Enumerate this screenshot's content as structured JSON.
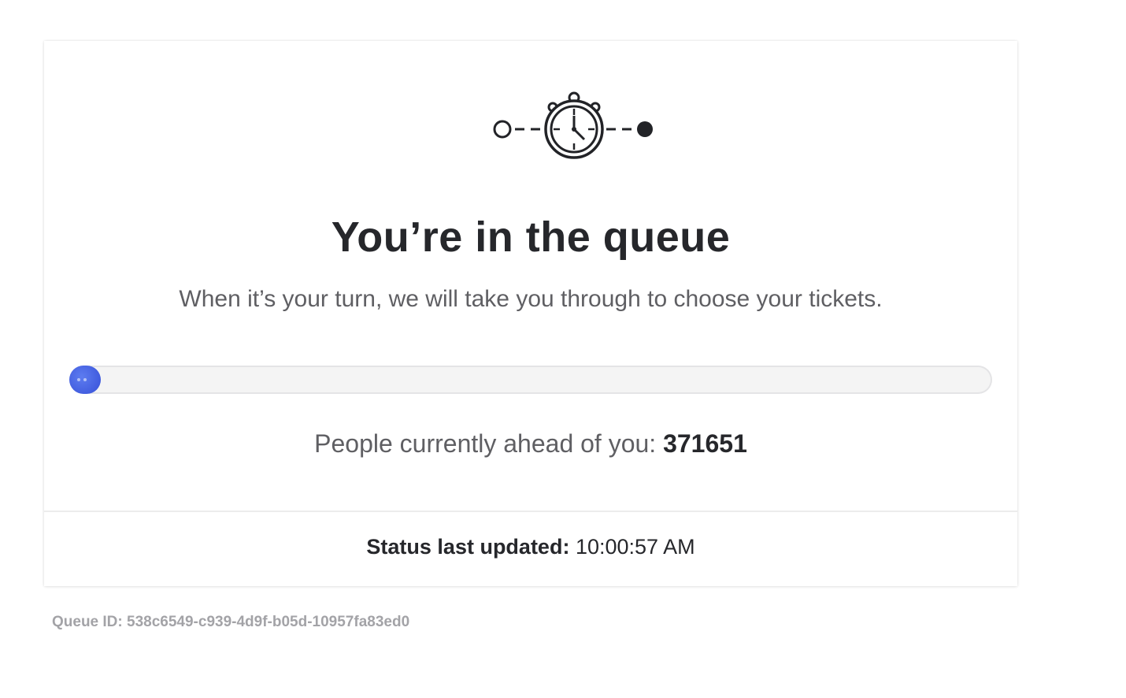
{
  "icon": "queue-stopwatch-icon",
  "colors": {
    "progress_fill": "#3f5de0",
    "title_text": "#26272b",
    "body_text": "#5f5f63",
    "muted_text": "#a3a3a7"
  },
  "queue": {
    "title": "You’re in the queue",
    "subtitle": "When it’s your turn, we will take you through to choose your tickets.",
    "progress_fraction": 0.0,
    "ahead_label": "People currently ahead of you:",
    "ahead_count": "371651"
  },
  "status": {
    "label": "Status last updated:",
    "time": "10:00:57 AM"
  },
  "footer": {
    "queue_id": "Queue ID: 538c6549-c939-4d9f-b05d-10957fa83ed0"
  }
}
